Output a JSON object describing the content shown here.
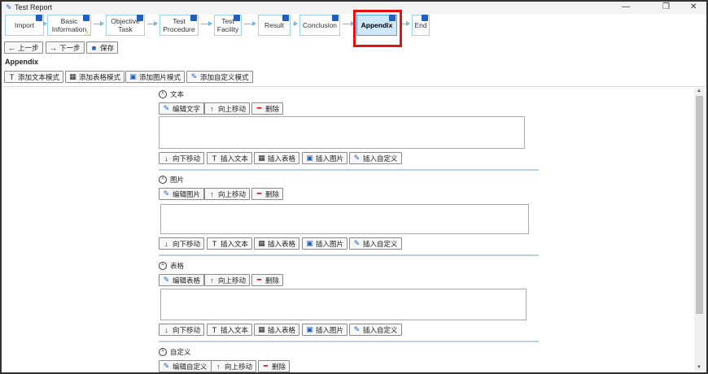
{
  "window": {
    "title": "Test Report",
    "minimize": "—",
    "restore": "❐",
    "close": "✕"
  },
  "steps": [
    {
      "label": "Import",
      "active": false,
      "warning": false
    },
    {
      "label": "Basic Information",
      "active": false,
      "warning": true
    },
    {
      "label": "Objective Task",
      "active": false,
      "warning": false
    },
    {
      "label": "Test Procedure",
      "active": false,
      "warning": false
    },
    {
      "label": "Test Facility",
      "active": false,
      "warning": false
    },
    {
      "label": "Result",
      "active": false,
      "warning": false
    },
    {
      "label": "Conclusion",
      "active": false,
      "warning": false
    },
    {
      "label": "Appendix",
      "active": true,
      "warning": false
    },
    {
      "label": "End",
      "active": false,
      "warning": false
    }
  ],
  "nav": {
    "prev": "上一步",
    "next": "下一步",
    "save": "保存"
  },
  "page_title": "Appendix",
  "toolbar": {
    "add_text": "添加文本模式",
    "add_table": "添加表格模式",
    "add_image": "添加图片模式",
    "add_custom": "添加自定义模式"
  },
  "sections": [
    {
      "title": "文本",
      "edit": "编辑文字",
      "up": "向上移动",
      "del": "删除",
      "down": "向下移动",
      "ins_text": "插入文本",
      "ins_table": "插入表格",
      "ins_image": "插入图片",
      "ins_custom": "插入自定义"
    },
    {
      "title": "图片",
      "edit": "编辑图片",
      "up": "向上移动",
      "del": "删除",
      "down": "向下移动",
      "ins_text": "插入文本",
      "ins_table": "插入表格",
      "ins_image": "插入图片",
      "ins_custom": "插入自定义"
    },
    {
      "title": "表格",
      "edit": "编辑表格",
      "up": "向上移动",
      "del": "删除",
      "down": "向下移动",
      "ins_text": "插入文本",
      "ins_table": "插入表格",
      "ins_image": "插入图片",
      "ins_custom": "插入自定义"
    },
    {
      "title": "自定义",
      "edit": "编辑自定义",
      "up": "向上移动",
      "del": "删除"
    }
  ]
}
